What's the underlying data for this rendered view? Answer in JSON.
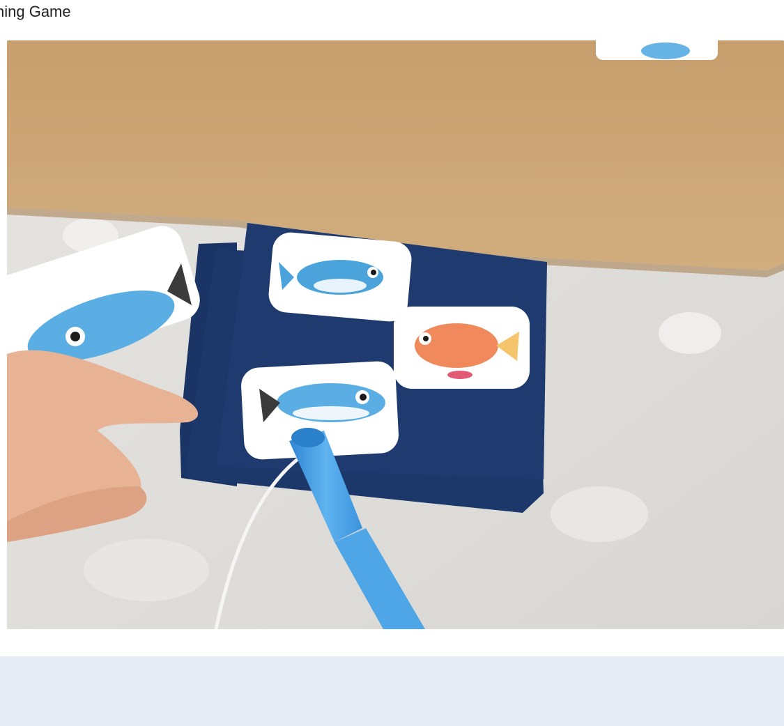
{
  "page": {
    "title": "hing Game"
  },
  "photo": {
    "subject_icons": [
      "fish-card-blue-top",
      "fish-card-orange",
      "fish-card-blue-bottom",
      "fish-card-blue-left",
      "fish-card-partial-top"
    ]
  },
  "colors": {
    "caption_panel": "#e4ebf3",
    "cardboard": "#c9a578",
    "navy_card": "#1e3a6e",
    "rod": "#4a9fe0"
  }
}
